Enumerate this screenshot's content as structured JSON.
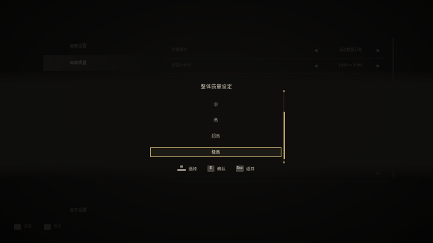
{
  "background_menu": {
    "categories": [
      "画面设置",
      "画面质量",
      "",
      "",
      "",
      "",
      "",
      "",
      "",
      "",
      "",
      "显示设置"
    ],
    "rows": [
      {
        "label": "屏幕模式",
        "value": "无边框窗口化"
      },
      {
        "label": "屏幕分辨率",
        "value": "1920 x 1080"
      },
      {
        "label": "",
        "value": ""
      },
      {
        "label": "",
        "value": ""
      },
      {
        "label": "",
        "value": ""
      },
      {
        "label": "",
        "value": ""
      },
      {
        "label": "",
        "value": ""
      },
      {
        "label": "",
        "value": ""
      },
      {
        "label": "",
        "value": ""
      }
    ],
    "footer": [
      {
        "key": "",
        "label": "返回"
      },
      {
        "key": "",
        "label": "默认"
      }
    ]
  },
  "dialog": {
    "title": "整体质量设定",
    "options": [
      "中",
      "高",
      "超高",
      "极高"
    ],
    "selected_index": 3,
    "hints": [
      {
        "key": "",
        "label": "选择"
      },
      {
        "key": "E",
        "label": "确认"
      },
      {
        "key": "Esc",
        "label": "返回"
      }
    ]
  }
}
